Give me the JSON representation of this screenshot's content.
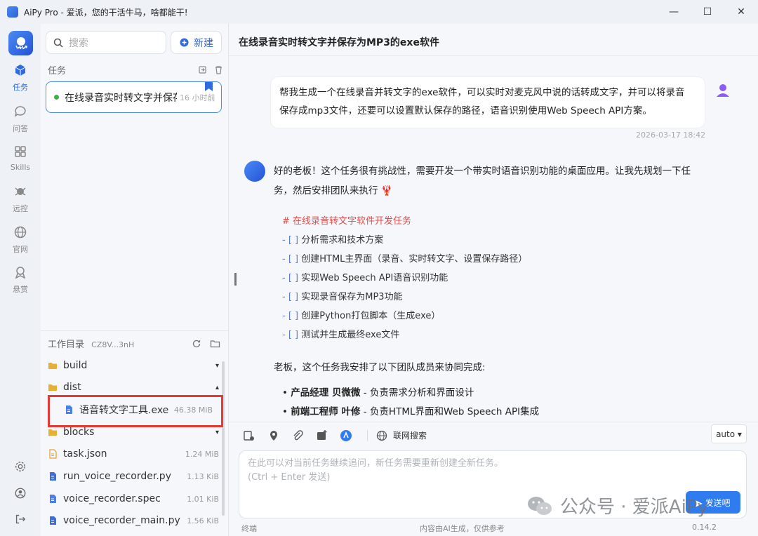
{
  "window": {
    "title": "AiPy Pro - 爱派，您的干活牛马，啥都能干!",
    "minimize": "—",
    "maximize": "☐",
    "close": "✕"
  },
  "nav": {
    "items": [
      {
        "label": "任务",
        "icon": "cube-icon",
        "active": true
      },
      {
        "label": "问答",
        "icon": "chat-bubble-icon"
      },
      {
        "label": "Skills",
        "icon": "grid-icon"
      },
      {
        "label": "远控",
        "icon": "remote-control-icon"
      },
      {
        "label": "官网",
        "icon": "globe-icon"
      },
      {
        "label": "悬赏",
        "icon": "bounty-icon"
      }
    ],
    "bottom": [
      "gear-icon",
      "user-circle-icon",
      "logout-icon"
    ]
  },
  "panel": {
    "search_placeholder": "搜索",
    "new_label": "新建",
    "tasks_header": "任务",
    "task": {
      "name": "在线录音实时转文字并保存",
      "time": "16 小时前"
    },
    "workdir_label": "工作目录",
    "workdir_code": "CZ8V...3nH",
    "files": [
      {
        "name": "build",
        "type": "folder",
        "toggle": "▾"
      },
      {
        "name": "dist",
        "type": "folder",
        "toggle": "▴"
      },
      {
        "name": "语音转文字工具.exe",
        "type": "file",
        "size": "46.38 MiB"
      },
      {
        "name": "blocks",
        "type": "folder",
        "toggle": "▾"
      },
      {
        "name": "task.json",
        "type": "json",
        "size": "1.24 MiB"
      },
      {
        "name": "run_voice_recorder.py",
        "type": "py",
        "size": "1.13 KiB"
      },
      {
        "name": "voice_recorder.spec",
        "type": "file",
        "size": "1.01 KiB"
      },
      {
        "name": "voice_recorder_main.py",
        "type": "py",
        "size": "1.56 KiB"
      }
    ]
  },
  "main": {
    "title": "在线录音实时转文字并保存为MP3的exe软件",
    "user_message": "帮我生成一个在线录音并转文字的exe软件，可以实时对麦克风中说的话转成文字，并可以将录音保存成mp3文件，还要可以设置默认保存的路径，语音识别使用Web Speech API方案。",
    "user_time": "2026-03-17 18:42",
    "ai_intro": "好的老板！这个任务很有挑战性，需要开发一个带实时语音识别功能的桌面应用。让我先规划一下任务，然后安排团队来执行 🦞",
    "checklist_title": "# 在线录音转文字软件开发任务",
    "checklist": [
      "分析需求和技术方案",
      "创建HTML主界面（录音、实时转文字、设置保存路径）",
      "实现Web Speech API语音识别功能",
      "实现录音保存为MP3功能",
      "创建Python打包脚本（生成exe）",
      "测试并生成最终exe文件"
    ],
    "checkbox_marker": "- [ ]",
    "team_intro": "老板，这个任务我安排了以下团队成员来协同完成:",
    "team": [
      {
        "role": "产品经理 贝微微",
        "desc": " - 负责需求分析和界面设计"
      },
      {
        "role": "前端工程师 叶修",
        "desc": " - 负责HTML界面和Web Speech API集成"
      }
    ]
  },
  "composer": {
    "web_search": "联网搜索",
    "model": "auto ▾",
    "placeholder_line1": "在此可以对当前任务继续追问，新任务需要重新创建全新任务。",
    "placeholder_line2": "(Ctrl + Enter 发送)",
    "send": "▶ 发送吧",
    "terminal": "终端",
    "disclaimer": "内容由AI生成，仅供参考",
    "version": "0.14.2"
  },
  "watermark": "公众号 · 爱派AiPy"
}
